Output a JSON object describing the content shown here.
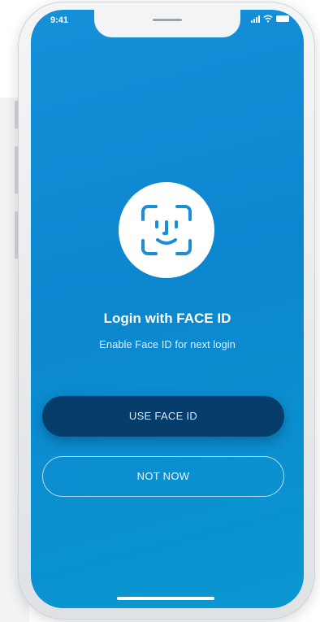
{
  "status_bar": {
    "time": "9:41",
    "icons": [
      "signal-icon",
      "wifi-icon",
      "battery-icon"
    ]
  },
  "face_id": {
    "icon": "face-id-icon"
  },
  "login": {
    "title": "Login with FACE ID",
    "subtitle": "Enable Face ID for next login"
  },
  "buttons": {
    "use_face_id": "USE FACE ID",
    "not_now": "NOT NOW"
  },
  "colors": {
    "screen_gradient_start": "#1590d9",
    "screen_gradient_end": "#0a97d0",
    "primary_button": "#073d6b"
  }
}
